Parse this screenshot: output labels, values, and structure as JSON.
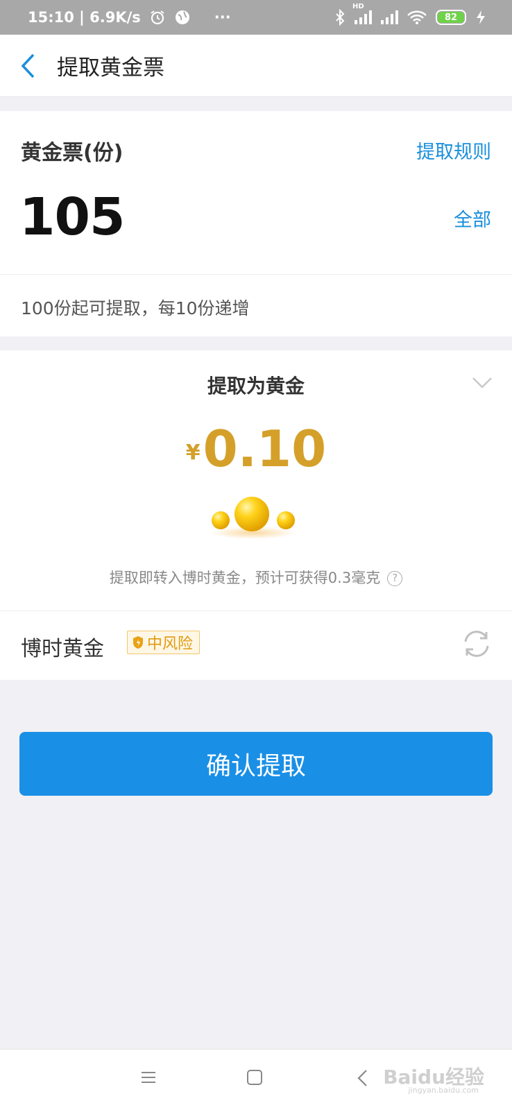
{
  "status_bar": {
    "time_speed": "15:10 | 6.9K/s",
    "more": "···",
    "hd": "HD",
    "battery": "82"
  },
  "header": {
    "title": "提取黄金票"
  },
  "ticket_card": {
    "label": "黄金票(份)",
    "rule_link": "提取规则",
    "amount": "105",
    "all_link": "全部",
    "hint": "100份起可提取，每10份递增"
  },
  "withdraw_card": {
    "title": "提取为黄金",
    "currency": "¥",
    "value": "0.10",
    "description": "提取即转入博时黄金，预计可获得0.3毫克",
    "help": "?",
    "fund_name": "博时黄金",
    "risk_level": "中风险"
  },
  "confirm_button": "确认提取",
  "watermark": {
    "text": "Baidu经验",
    "url": "jingyan.baidu.com"
  },
  "colors": {
    "accent": "#1a8fe6",
    "gold": "#d4a02a",
    "link": "#1a8fdc"
  }
}
